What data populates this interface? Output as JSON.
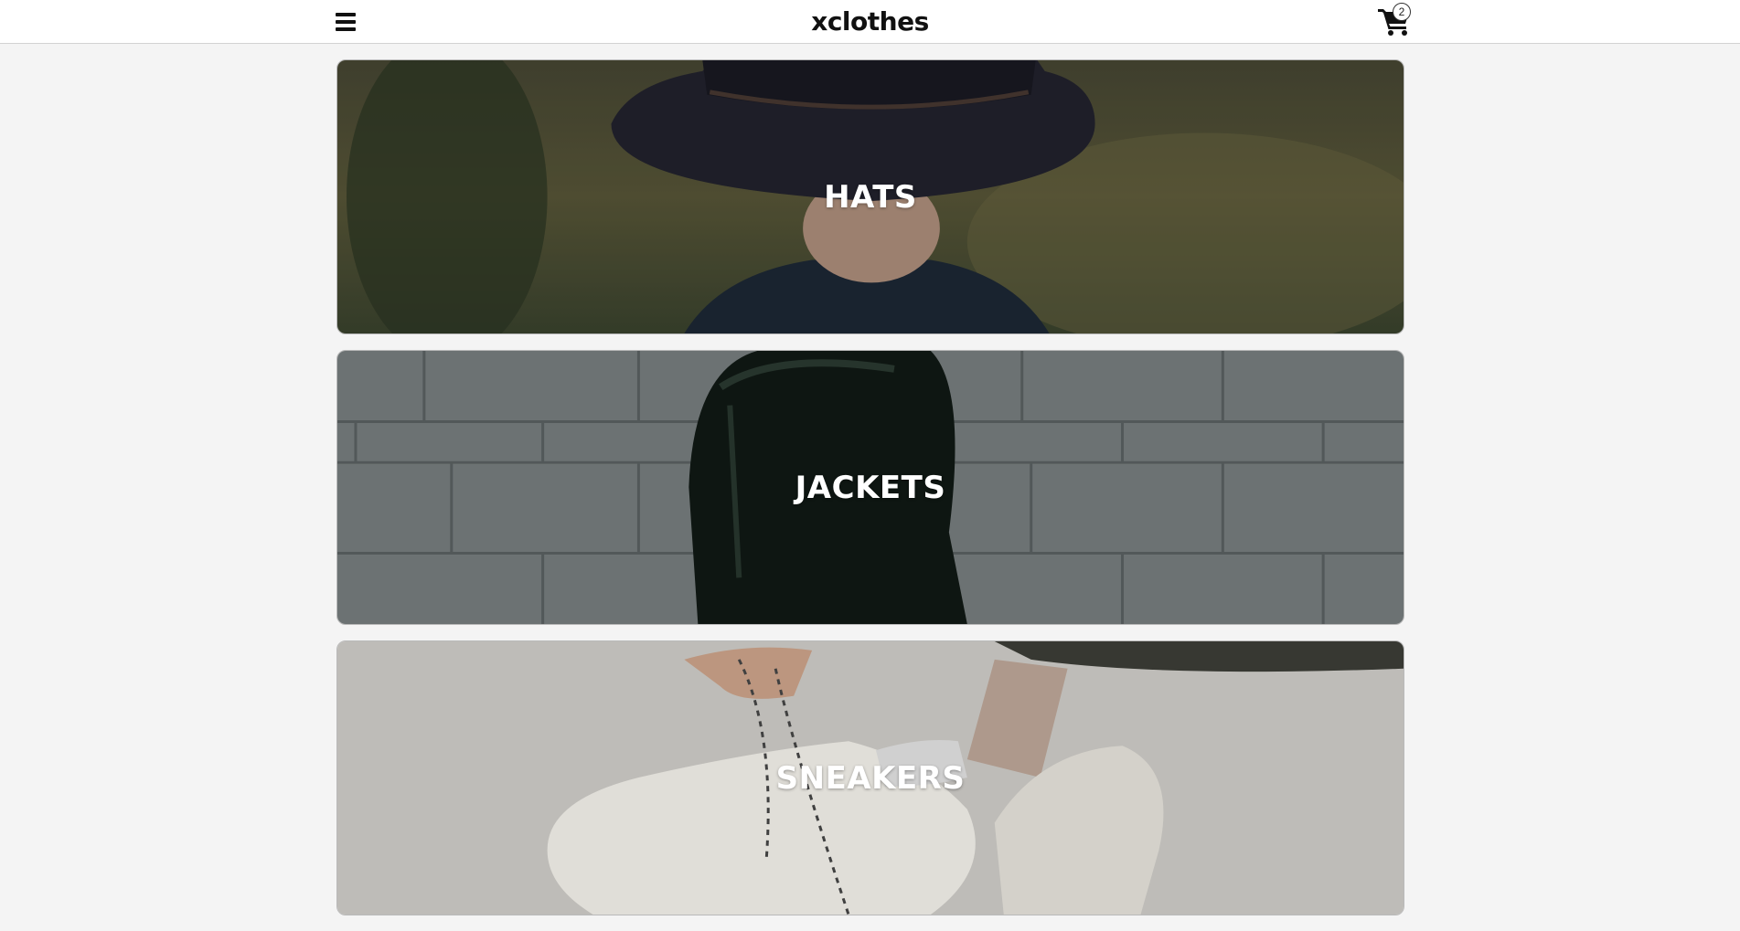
{
  "header": {
    "brand": "xclothes",
    "menu_icon": "hamburger-menu-icon",
    "cart_icon": "shopping-cart-icon",
    "cart_count": "2"
  },
  "categories": [
    {
      "label": "HATS",
      "image": "person-wearing-black-hat-photo"
    },
    {
      "label": "JACKETS",
      "image": "person-in-dark-green-jacket-photo"
    },
    {
      "label": "SNEAKERS",
      "image": "hands-tying-white-sneakers-photo"
    }
  ],
  "colors": {
    "background": "#f4f4f4",
    "header": "#ffffff",
    "label_text": "#ffffff"
  }
}
